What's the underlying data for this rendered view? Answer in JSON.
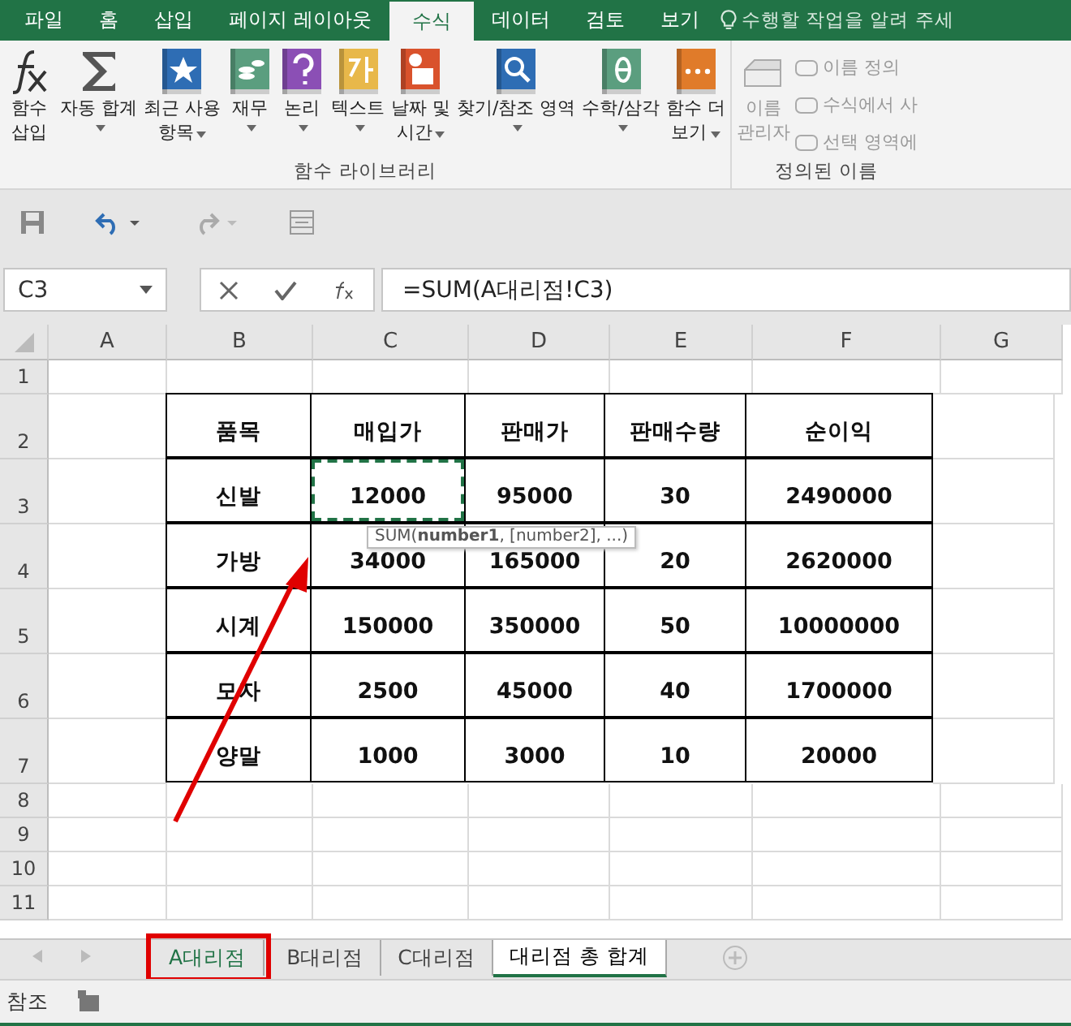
{
  "ribbon_tabs": [
    {
      "label": "파일",
      "selected": false
    },
    {
      "label": "홈",
      "selected": false
    },
    {
      "label": "삽입",
      "selected": false
    },
    {
      "label": "페이지 레이아웃",
      "selected": false
    },
    {
      "label": "수식",
      "selected": true
    },
    {
      "label": "데이터",
      "selected": false
    },
    {
      "label": "검토",
      "selected": false
    },
    {
      "label": "보기",
      "selected": false
    }
  ],
  "tell_me": "수행할 작업을 알려 주세",
  "function_library": {
    "label": "함수 라이브러리",
    "buttons": [
      {
        "kind": "fx",
        "lines": [
          "함수",
          "삽입"
        ],
        "dropdown": false
      },
      {
        "kind": "sum",
        "lines": [
          "자동 합계"
        ],
        "dropdown": true
      },
      {
        "kind": "star",
        "lines": [
          "최근 사용",
          "항목"
        ],
        "dropdown": true
      },
      {
        "kind": "coins",
        "lines": [
          "재무"
        ],
        "dropdown": true
      },
      {
        "kind": "question",
        "lines": [
          "논리"
        ],
        "dropdown": true
      },
      {
        "kind": "text",
        "lines": [
          "텍스트"
        ],
        "dropdown": true
      },
      {
        "kind": "calendar",
        "lines": [
          "날짜 및",
          "시간"
        ],
        "dropdown": true
      },
      {
        "kind": "search",
        "lines": [
          "찾기/참조 영역"
        ],
        "dropdown": true
      },
      {
        "kind": "theta",
        "lines": [
          "수학/삼각"
        ],
        "dropdown": true
      },
      {
        "kind": "more",
        "lines": [
          "함수 더",
          "보기"
        ],
        "dropdown": true
      }
    ]
  },
  "defined_names": {
    "label": "정의된 이름",
    "manager": {
      "lines": [
        "이름",
        "관리자"
      ],
      "disabled": true
    },
    "items": [
      {
        "label": "이름 정의",
        "disabled": true
      },
      {
        "label": "수식에서 사",
        "disabled": true
      },
      {
        "label": "선택 영역에",
        "disabled": true
      }
    ]
  },
  "name_box": "C3",
  "formula": "=SUM(A대리점!C3)",
  "columns": [
    "A",
    "B",
    "C",
    "D",
    "E",
    "F",
    "G"
  ],
  "rows": [
    "1",
    "2",
    "3",
    "4",
    "5",
    "6",
    "7",
    "8",
    "9",
    "10",
    "11"
  ],
  "table": {
    "header": [
      "품목",
      "매입가",
      "판매가",
      "판매수량",
      "순이익"
    ],
    "rows": [
      [
        {
          "text": "신발",
          "copied": false
        },
        {
          "text": "12000",
          "copied": true
        },
        {
          "text": "95000",
          "copied": false
        },
        {
          "text": "30",
          "copied": false
        },
        {
          "text": "2490000",
          "copied": false
        }
      ],
      [
        {
          "text": "가방",
          "copied": false
        },
        {
          "text": "34000",
          "copied": false
        },
        {
          "text": "165000",
          "copied": false
        },
        {
          "text": "20",
          "copied": false
        },
        {
          "text": "2620000",
          "copied": false
        }
      ],
      [
        {
          "text": "시계",
          "copied": false
        },
        {
          "text": "150000",
          "copied": false
        },
        {
          "text": "350000",
          "copied": false
        },
        {
          "text": "50",
          "copied": false
        },
        {
          "text": "10000000",
          "copied": false
        }
      ],
      [
        {
          "text": "모자",
          "copied": false
        },
        {
          "text": "2500",
          "copied": false
        },
        {
          "text": "45000",
          "copied": false
        },
        {
          "text": "40",
          "copied": false
        },
        {
          "text": "1700000",
          "copied": false
        }
      ],
      [
        {
          "text": "양말",
          "copied": false
        },
        {
          "text": "1000",
          "copied": false
        },
        {
          "text": "3000",
          "copied": false
        },
        {
          "text": "10",
          "copied": false
        },
        {
          "text": "20000",
          "copied": false
        }
      ]
    ]
  },
  "tooltip": "SUM(**number1**, [number2], ...)",
  "sheet_tabs": [
    {
      "label": "A대리점",
      "selected": false,
      "highlighted": true
    },
    {
      "label": "B대리점",
      "selected": false,
      "highlighted": false
    },
    {
      "label": "C대리점",
      "selected": false,
      "highlighted": false
    },
    {
      "label": "대리점 총 합계",
      "selected": true,
      "highlighted": false
    }
  ],
  "status": "참조"
}
